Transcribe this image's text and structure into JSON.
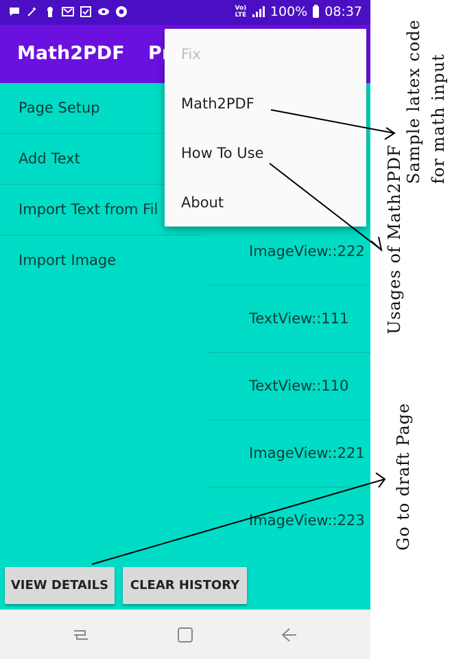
{
  "status_bar": {
    "battery": "100%",
    "time": "08:37",
    "volte": "Vo) LTE",
    "left_icons": [
      "message-icon",
      "magic-wand-icon",
      "keyhole-icon",
      "mail-icon",
      "checkbox-icon",
      "eye-icon",
      "chrome-icon"
    ]
  },
  "app_bar": {
    "title": "Math2PDF",
    "subtitle_partial": "Pr"
  },
  "menu": {
    "items": [
      {
        "label": "Page Setup"
      },
      {
        "label": "Add Text"
      },
      {
        "label": "Import Text from Fil"
      },
      {
        "label": "Import Image"
      }
    ]
  },
  "list": {
    "rows": [
      {
        "label": "ImageView::222"
      },
      {
        "label": "TextView::111"
      },
      {
        "label": "TextView::110"
      },
      {
        "label": "ImageView::221"
      },
      {
        "label": "ImageView::223"
      }
    ]
  },
  "buttons": {
    "view_details": "VIEW DETAILS",
    "clear_history": "CLEAR HISTORY"
  },
  "overflow_menu": {
    "items": [
      {
        "label": "Fix",
        "enabled": false
      },
      {
        "label": "Math2PDF",
        "enabled": true
      },
      {
        "label": "How To Use",
        "enabled": true
      },
      {
        "label": "About",
        "enabled": true
      }
    ]
  },
  "annotations": {
    "latex_line1": "Sample latex code",
    "latex_line2": "for math input",
    "usages": "Usages of Math2PDF",
    "draft": "Go to draft Page"
  },
  "colors": {
    "status_bar": "#4a0fc3",
    "app_bar": "#6a11e0",
    "content_bg": "#00dcc5",
    "nav_bar": "#f1f1f1"
  }
}
